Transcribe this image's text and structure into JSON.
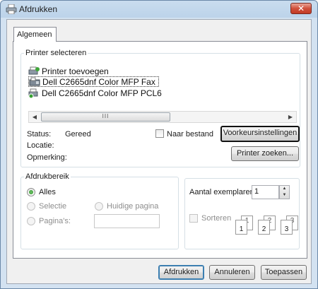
{
  "window": {
    "title": "Afdrukken",
    "close_glyph": "✕"
  },
  "tabs": [
    {
      "label": "Algemeen"
    }
  ],
  "printer_select": {
    "legend": "Printer selecteren",
    "printers": [
      {
        "name": "Printer toevoegen",
        "icon": "add-printer-icon"
      },
      {
        "name": "Dell C2665dnf Color MFP Fax",
        "icon": "fax-printer-icon",
        "selected": true
      },
      {
        "name": "Dell C2665dnf Color MFP PCL6",
        "icon": "default-printer-icon"
      }
    ],
    "scrollbar_grip": "III",
    "status_label": "Status:",
    "status_value": "Gereed",
    "location_label": "Locatie:",
    "comment_label": "Opmerking:",
    "print_to_file_label": "Naar bestand",
    "preferences_button": "Voorkeursinstellingen",
    "find_printer_button": "Printer zoeken..."
  },
  "page_range": {
    "legend": "Afdrukbereik",
    "all_label": "Alles",
    "selection_label": "Selectie",
    "current_page_label": "Huidige pagina",
    "pages_label": "Pagina's:",
    "pages_value": ""
  },
  "copies": {
    "count_label": "Aantal exemplaren:",
    "count_value": "1",
    "collate_label": "Sorteren",
    "collate_pages": [
      "1",
      "1",
      "2",
      "2",
      "3",
      "3"
    ]
  },
  "footer": {
    "print_button": "Afdrukken",
    "cancel_button": "Annuleren",
    "apply_button": "Toepassen"
  }
}
